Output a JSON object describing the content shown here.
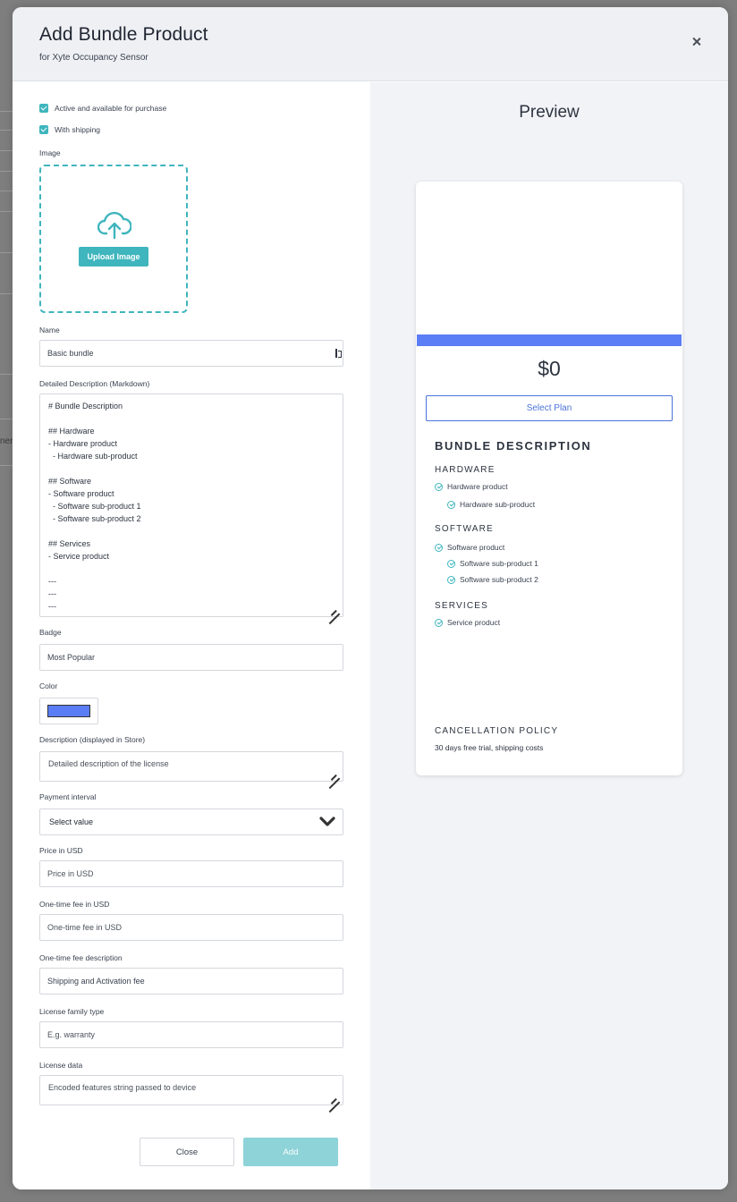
{
  "background": {
    "edge_text": "nen"
  },
  "modal": {
    "title": "Add Bundle Product",
    "subtitle": "for Xyte Occupancy Sensor"
  },
  "form": {
    "active_label": "Active and available for purchase",
    "shipping_label": "With shipping",
    "image_label": "Image",
    "upload_button": "Upload Image",
    "name_label": "Name",
    "name_value": "Basic bundle",
    "detailed_label": "Detailed Description (Markdown)",
    "detailed_lines": [
      "# Bundle Description",
      "",
      "## Hardware",
      "- Hardware product",
      "  - Hardware sub-product",
      "",
      "## Software",
      "- Software product",
      "  - Software sub-product 1",
      "  - Software sub-product 2",
      "",
      "## Services",
      "- Service product",
      "",
      "---",
      "---",
      "---"
    ],
    "badge_label": "Badge",
    "badge_value": "Most Popular",
    "color_label": "Color",
    "color_value": "#5b7df5",
    "store_desc_label": "Description (displayed in Store)",
    "store_desc_placeholder": "Detailed description of the license",
    "interval_label": "Payment interval",
    "interval_value": "Select value",
    "price_label": "Price in USD",
    "price_placeholder": "Price in USD",
    "fee_label": "One-time fee in USD",
    "fee_placeholder": "One-time fee in USD",
    "fee_desc_label": "One-time fee description",
    "fee_desc_value": "Shipping and Activation fee",
    "family_label": "License family type",
    "family_placeholder": "E.g. warranty",
    "license_data_label": "License data",
    "license_data_placeholder": "Encoded features string passed to device",
    "close_button": "Close",
    "add_button": "Add"
  },
  "preview": {
    "title": "Preview",
    "price": "$0",
    "select_plan": "Select Plan",
    "bar_color": "#5b7df5",
    "bundle_heading": "BUNDLE DESCRIPTION",
    "hardware_heading": "HARDWARE",
    "hardware_items": [
      "Hardware product",
      "Hardware sub-product"
    ],
    "software_heading": "SOFTWARE",
    "software_items": [
      "Software product",
      "Software sub-product 1",
      "Software sub-product 2"
    ],
    "services_heading": "SERVICES",
    "services_items": [
      "Service product"
    ],
    "policy_heading": "CANCELLATION POLICY",
    "policy_text": "30 days free trial, shipping costs"
  },
  "colors": {
    "accent": "#3fb5bd",
    "primary_blue": "#4b73d9",
    "add_disabled": "#8ed3d8"
  }
}
